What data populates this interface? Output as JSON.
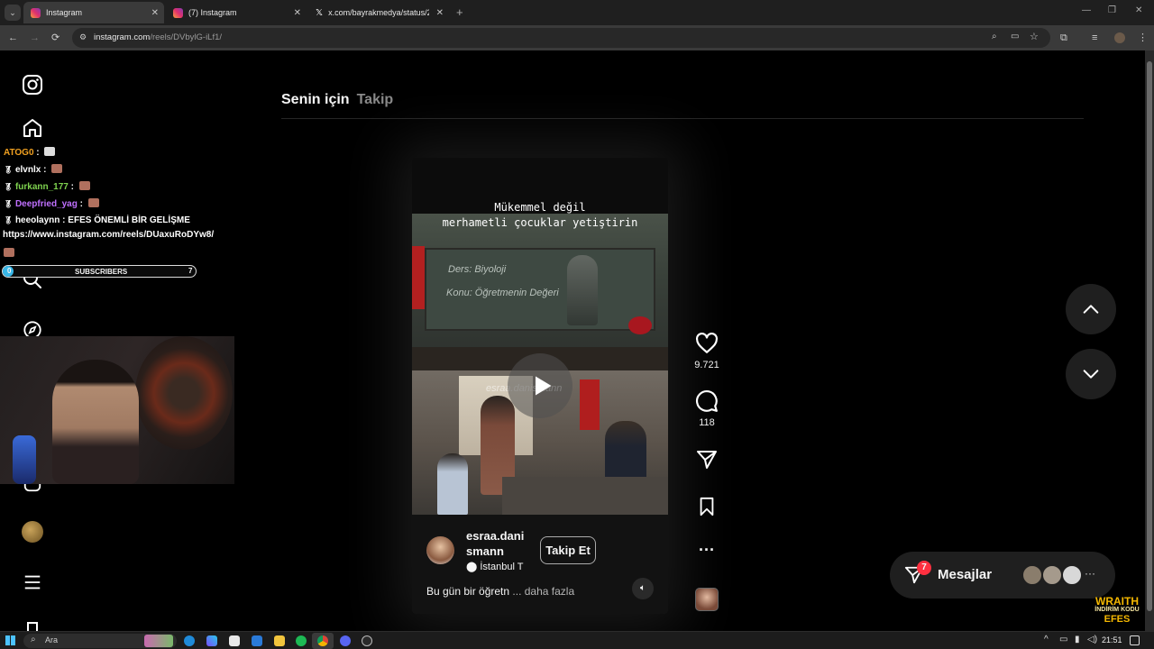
{
  "browser": {
    "tabs": [
      {
        "title": "Instagram",
        "active": true
      },
      {
        "title": "(7) Instagram",
        "active": false
      },
      {
        "title": "x.com/bayrakmedya/status/20...",
        "active": false
      }
    ],
    "url_host": "instagram.com",
    "url_path": "/reels/DVbylG-iLf1/"
  },
  "feed": {
    "tab_for_you": "Senin için",
    "tab_following": "Takip"
  },
  "reel": {
    "caption_line1": "Mükemmel değil",
    "caption_line2": "merhametli çocuklar yetiştirin",
    "board_line1": "Ders: Biyoloji",
    "board_line2": "Konu: Öğretmenin Değeri",
    "watermark": "esraa.danismann",
    "username_line1": "esraa.dani",
    "username_line2": "smann",
    "location": "İstanbul T",
    "follow_label": "Takip Et",
    "description": "Bu gün bir öğretn",
    "more_label": "... daha fazla"
  },
  "actions": {
    "likes": "9.721",
    "comments": "118"
  },
  "messages": {
    "label": "Mesajlar",
    "badge": "7"
  },
  "overlay": {
    "chat": [
      {
        "user": "ATOG0",
        "text": "",
        "color": "#f0a020"
      },
      {
        "user": "elvnlx",
        "text": "",
        "color": "#ffffff"
      },
      {
        "user": "furkann_177",
        "text": "",
        "color": "#7fd34f"
      },
      {
        "user": "Deepfried_yag",
        "text": "",
        "color": "#c070ff"
      },
      {
        "user": "heeolaynn",
        "text": "EFES ÖNEMLİ BİR GELİŞME",
        "color": "#ffffff"
      }
    ],
    "chat_link": "https://www.instagram.com/reels/DUaxuRoDYw8/",
    "subs_label": "SUBSCRIBERS",
    "subs_start": "0",
    "subs_goal": "7",
    "subs_progress": 0.02,
    "brand_line1": "WRAITH",
    "brand_line2": "İNDİRİM KODU",
    "brand_line3": "EFES"
  },
  "taskbar": {
    "search_placeholder": "Ara",
    "time": "21:51"
  },
  "colors": {
    "accent_red": "#ff3040",
    "page_bg": "#000000",
    "overlay_gold": "#f5b800"
  }
}
